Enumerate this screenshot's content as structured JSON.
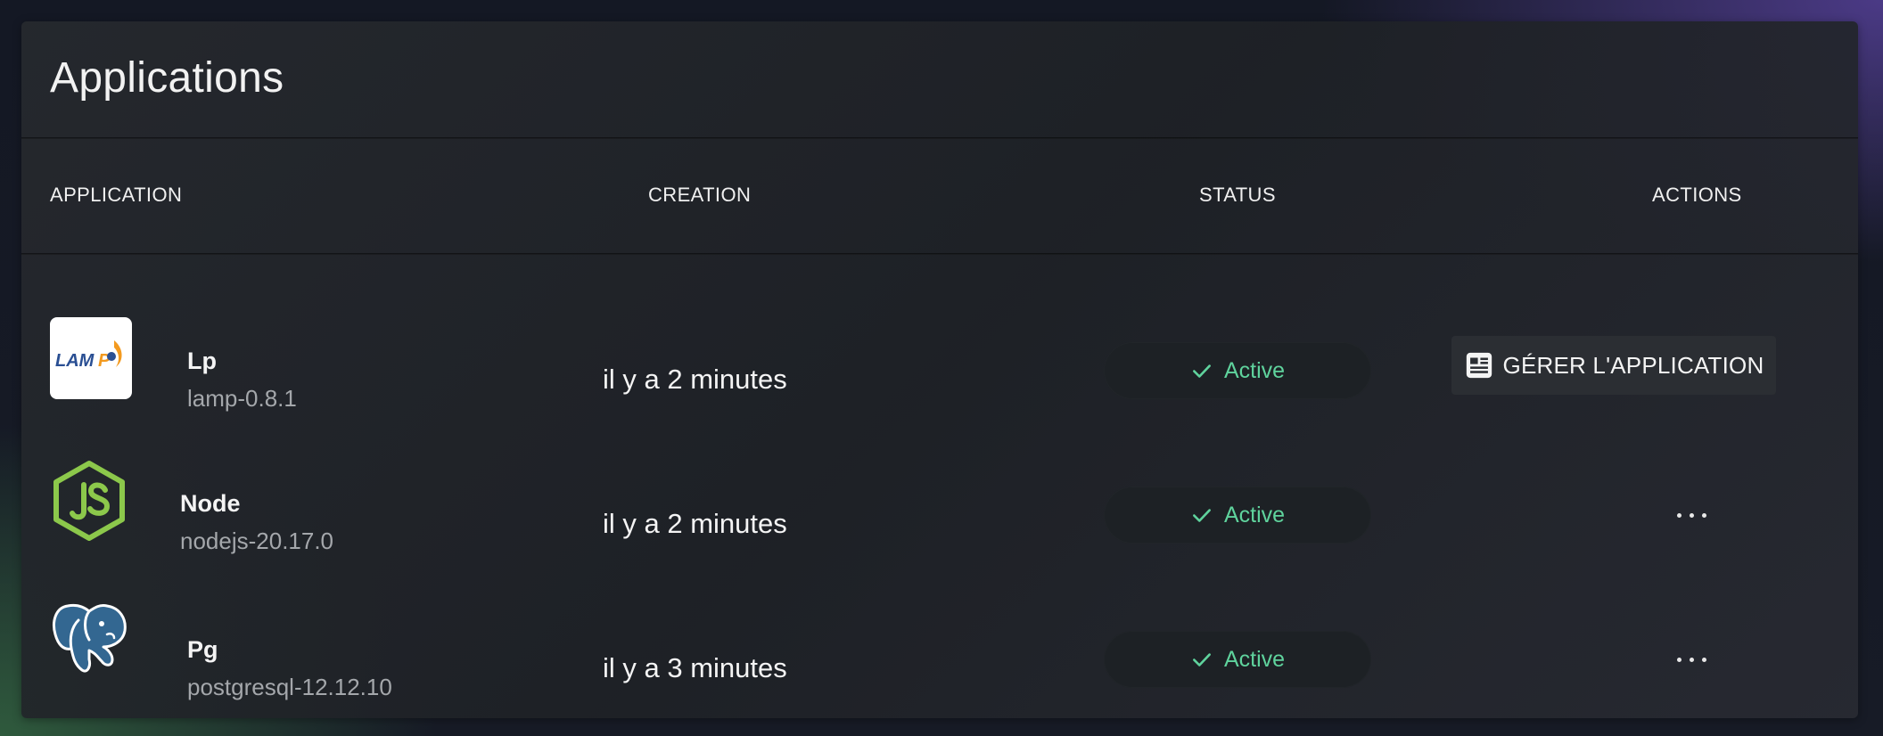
{
  "card": {
    "title": "Applications"
  },
  "table": {
    "headers": {
      "application": "APPLICATION",
      "creation": "CREATION",
      "status": "STATUS",
      "actions": "ACTIONS"
    },
    "rows": [
      {
        "name": "Lp",
        "version": "lamp-0.8.1",
        "created": "il y a 2 minutes",
        "status": "Active",
        "logo": "lamp-logo",
        "action_label": "GÉRER L'APPLICATION"
      },
      {
        "name": "Node",
        "version": "nodejs-20.17.0",
        "created": "il y a 2 minutes",
        "status": "Active",
        "logo": "nodejs-logo"
      },
      {
        "name": "Pg",
        "version": "postgresql-12.12.10",
        "created": "il y a 3 minutes",
        "status": "Active",
        "logo": "postgresql-logo"
      }
    ]
  },
  "colors": {
    "status_active": "#5fd39d",
    "nodejs_green": "#8cc84b",
    "postgres_blue": "#336791"
  },
  "icons": {
    "check": "check-icon",
    "manage": "article-icon",
    "more": "more-horizontal-icon"
  }
}
